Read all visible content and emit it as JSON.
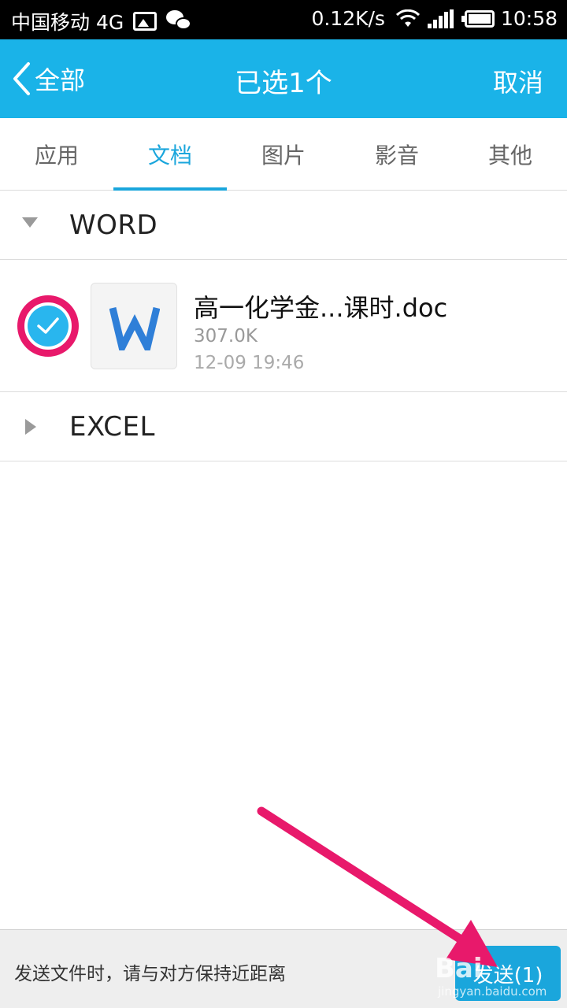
{
  "status_bar": {
    "carrier": "中国移动 4G",
    "net_speed": "0.12K/s",
    "time": "10:58",
    "icons": [
      "image-icon",
      "wechat-icon",
      "wifi-icon",
      "signal-icon",
      "battery-icon"
    ]
  },
  "title_bar": {
    "back_label": "全部",
    "title": "已选1个",
    "cancel_label": "取消",
    "color": "#1ab3e8"
  },
  "tabs": [
    {
      "label": "应用",
      "active": false
    },
    {
      "label": "文档",
      "active": true
    },
    {
      "label": "图片",
      "active": false
    },
    {
      "label": "影音",
      "active": false
    },
    {
      "label": "其他",
      "active": false
    }
  ],
  "groups": {
    "word": {
      "label": "WORD",
      "expanded": true,
      "files": [
        {
          "name": "高一化学金...课时.doc",
          "size": "307.0K",
          "date": "12-09 19:46",
          "selected": true,
          "icon": "word-doc-icon"
        }
      ]
    },
    "excel": {
      "label": "EXCEL",
      "expanded": false
    }
  },
  "bottom_bar": {
    "hint": "发送文件时，请与对方保持近距离",
    "send_label": "发送(1)"
  },
  "watermark": {
    "text": "Bai",
    "url": "jingyan.baidu.com"
  },
  "colors": {
    "accent": "#1aa6dc",
    "annotation": "#e8196b"
  }
}
